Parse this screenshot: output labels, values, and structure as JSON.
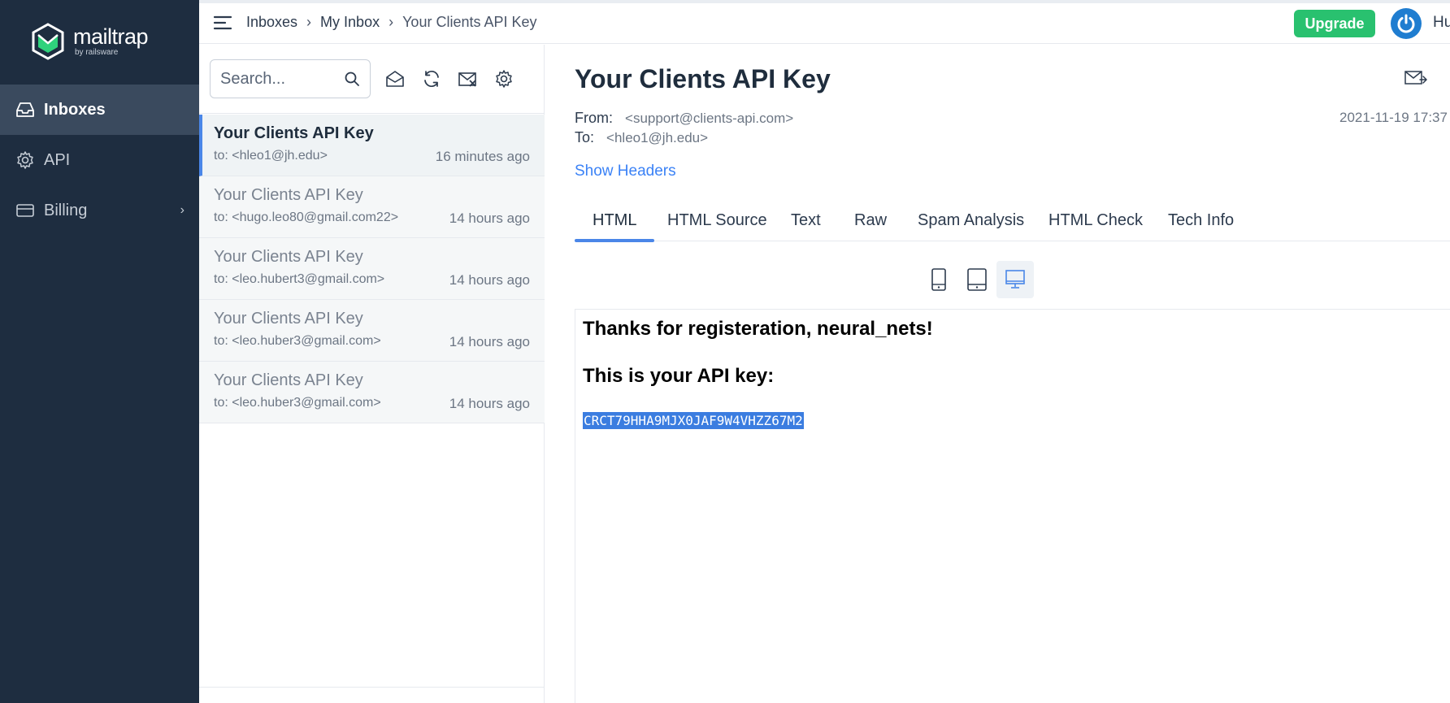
{
  "app": {
    "logo_name": "mailtrap",
    "logo_sub": "by railsware"
  },
  "sidebar": {
    "items": [
      {
        "label": "Inboxes",
        "icon": "inbox-icon",
        "active": true
      },
      {
        "label": "API",
        "icon": "gear-icon",
        "active": false
      },
      {
        "label": "Billing",
        "icon": "card-icon",
        "active": false,
        "chevron": "›"
      }
    ]
  },
  "topbar": {
    "breadcrumb": [
      "Inboxes",
      "My Inbox",
      "Your Clients API Key"
    ],
    "separator": "›",
    "upgrade_label": "Upgrade",
    "user_name": "Hu"
  },
  "message_list": {
    "search_placeholder": "Search...",
    "toolbar_icons": [
      "mark-read-icon",
      "refresh-icon",
      "clear-inbox-icon",
      "settings-icon"
    ],
    "items": [
      {
        "subject": "Your Clients API Key",
        "to": "to: <hleo1@jh.edu>",
        "time": "16 minutes ago",
        "active": true
      },
      {
        "subject": "Your Clients API Key",
        "to": "to: <hugo.leo80@gmail.com22>",
        "time": "14 hours ago",
        "active": false
      },
      {
        "subject": "Your Clients API Key",
        "to": "to: <leo.hubert3@gmail.com>",
        "time": "14 hours ago",
        "active": false
      },
      {
        "subject": "Your Clients API Key",
        "to": "to: <leo.huber3@gmail.com>",
        "time": "14 hours ago",
        "active": false
      },
      {
        "subject": "Your Clients API Key",
        "to": "to: <leo.huber3@gmail.com>",
        "time": "14 hours ago",
        "active": false
      }
    ]
  },
  "detail": {
    "title": "Your Clients API Key",
    "from_label": "From:",
    "from_value": "<support@clients-api.com>",
    "to_label": "To:",
    "to_value": "<hleo1@jh.edu>",
    "date": "2021-11-19 17:37",
    "show_headers": "Show Headers",
    "tabs": [
      "HTML",
      "HTML Source",
      "Text",
      "Raw",
      "Spam Analysis",
      "HTML Check",
      "Tech Info"
    ],
    "active_tab": "HTML",
    "devices": [
      "mobile-icon",
      "tablet-icon",
      "desktop-icon"
    ],
    "active_device": "desktop-icon",
    "body": {
      "heading1": "Thanks for registeration, neural_nets!",
      "heading2": "This is your API key:",
      "api_key": "CRCT79HHA9MJX0JAF9W4VHZZ67M2"
    }
  },
  "colors": {
    "sidebar_bg": "#1e2d40",
    "accent": "#4a86e8",
    "upgrade": "#29c16f",
    "selection": "#3b7de0"
  }
}
